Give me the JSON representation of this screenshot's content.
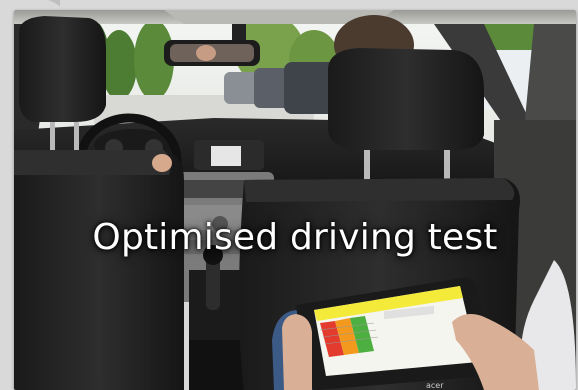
{
  "caption": "Optimised driving test",
  "tablet_brand": "acer",
  "colors": {
    "background": "#d9d9d9",
    "caption_text": "#ffffff",
    "tablet_red": "#e33b2e",
    "tablet_orange": "#f39a1e",
    "tablet_green": "#4caf3f",
    "tablet_yellow": "#f4ea3a"
  }
}
